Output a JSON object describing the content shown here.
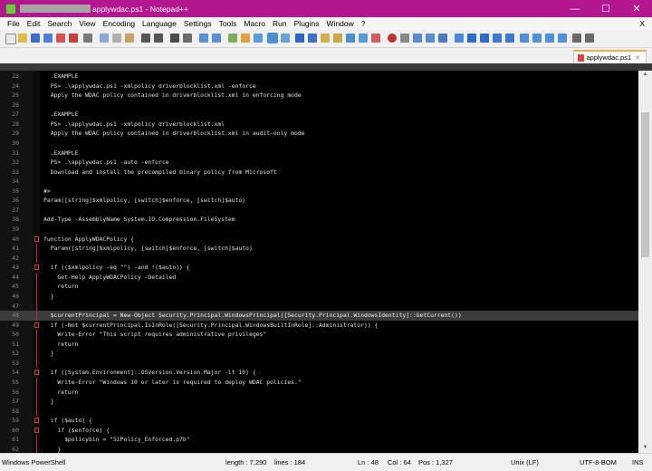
{
  "window": {
    "title": "applywdac.ps1 - Notepad++",
    "minimize": "—",
    "maximize": "☐",
    "close": "✕"
  },
  "menu": [
    "File",
    "Edit",
    "Search",
    "View",
    "Encoding",
    "Language",
    "Settings",
    "Tools",
    "Macro",
    "Run",
    "Plugins",
    "Window",
    "?"
  ],
  "menu_close": "X",
  "tab": {
    "label": "applywdac.ps1",
    "close": "✕"
  },
  "lines": [
    {
      "n": "23",
      "t": "  .EXAMPLE"
    },
    {
      "n": "24",
      "t": "  PS> .\\applywdac.ps1 -xmlpolicy driverblocklist.xml -enforce"
    },
    {
      "n": "25",
      "t": "  Apply the WDAC policy contained in driverblocklist.xml in enforcing mode"
    },
    {
      "n": "26",
      "t": ""
    },
    {
      "n": "27",
      "t": "  .EXAMPLE"
    },
    {
      "n": "28",
      "t": "  PS> .\\applywdac.ps1 -xmlpolicy driverblocklist.xml"
    },
    {
      "n": "29",
      "t": "  Apply the WDAC policy contained in driverblocklist.xml in audit-only mode"
    },
    {
      "n": "30",
      "t": ""
    },
    {
      "n": "31",
      "t": "  .EXAMPLE"
    },
    {
      "n": "32",
      "t": "  PS> .\\applywdac.ps1 -auto -enforce"
    },
    {
      "n": "33",
      "t": "  Download and install the precompiled binary policy from Microsoft"
    },
    {
      "n": "34",
      "t": ""
    },
    {
      "n": "35",
      "t": "#>"
    },
    {
      "n": "36",
      "t": "Param([string]$xmlpolicy, [switch]$enforce, [switch]$auto)"
    },
    {
      "n": "37",
      "t": ""
    },
    {
      "n": "38",
      "t": "Add-Type -AssemblyName System.IO.Compression.FileSystem"
    },
    {
      "n": "39",
      "t": ""
    },
    {
      "n": "40",
      "t": "function ApplyWDACPolicy {"
    },
    {
      "n": "41",
      "t": "  Param([string]$xmlpolicy, [switch]$enforce, [switch]$auto)"
    },
    {
      "n": "42",
      "t": ""
    },
    {
      "n": "43",
      "t": "  if (($xmlpolicy -eq \"\") -and !($auto)) {"
    },
    {
      "n": "44",
      "t": "    Get-Help ApplyWDACPolicy -Detailed"
    },
    {
      "n": "45",
      "t": "    return"
    },
    {
      "n": "46",
      "t": "  }"
    },
    {
      "n": "47",
      "t": ""
    },
    {
      "n": "48",
      "t": "  $currentPrincipal = New-Object Security.Principal.WindowsPrincipal([Security.Principal.WindowsIdentity]::GetCurrent())"
    },
    {
      "n": "49",
      "t": "  if (-Not $currentPrincipal.IsInRole([Security.Principal.WindowsBuiltInRole]::Administrator)) {"
    },
    {
      "n": "50",
      "t": "    Write-Error \"This script requires administrative privileges\""
    },
    {
      "n": "51",
      "t": "    return"
    },
    {
      "n": "52",
      "t": "  }"
    },
    {
      "n": "53",
      "t": ""
    },
    {
      "n": "54",
      "t": "  if ([System.Environment]::OSVersion.Version.Major -lt 10) {"
    },
    {
      "n": "55",
      "t": "    Write-Error \"Windows 10 or later is required to deploy WDAC policies.\""
    },
    {
      "n": "56",
      "t": "    return"
    },
    {
      "n": "57",
      "t": "  }"
    },
    {
      "n": "58",
      "t": ""
    },
    {
      "n": "59",
      "t": "  if ($auto) {"
    },
    {
      "n": "60",
      "t": "    if ($enforce) {"
    },
    {
      "n": "61",
      "t": "      $policybin = \"SiPolicy_Enforced.p7b\""
    },
    {
      "n": "62",
      "t": "    }"
    }
  ],
  "status": {
    "language": "Windows PowerShell",
    "length": "length : 7,290",
    "lines": "lines : 184",
    "ln": "Ln : 48",
    "col": "Col : 64",
    "pos": "Pos : 1,327",
    "eol": "Unix (LF)",
    "encoding": "UTF-8-BOM",
    "mode": "INS"
  },
  "colors": {
    "titlebar": "#b4168f",
    "editor_bg": "#000000",
    "current_line": "#3c3c3c"
  }
}
